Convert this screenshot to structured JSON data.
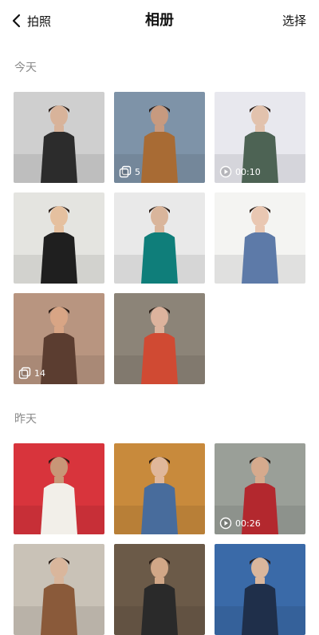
{
  "header": {
    "back_label": "拍照",
    "title": "相册",
    "select_label": "选择"
  },
  "sections": [
    {
      "label": "今天",
      "tiles": [
        {
          "name": "photo-woman-black-vest",
          "bg": "#cfcfcf",
          "accent": "#2c2c2c",
          "skin": "#d8b39a",
          "badge": null
        },
        {
          "name": "photo-man-brown-jacket",
          "bg": "#7e93a8",
          "accent": "#a86b34",
          "skin": "#c79a7f",
          "badge": {
            "type": "multi",
            "text": "5"
          }
        },
        {
          "name": "photo-woman-green-top",
          "bg": "#e8e8ee",
          "accent": "#4d6354",
          "skin": "#e2c2ad",
          "badge": {
            "type": "video",
            "text": "00:10"
          }
        },
        {
          "name": "photo-woman-glasses-bomber",
          "bg": "#e4e4e0",
          "accent": "#1f1f1f",
          "skin": "#e5c09f",
          "badge": null
        },
        {
          "name": "photo-teal-sweater-bag",
          "bg": "#e9e9e9",
          "accent": "#0f7e7a",
          "skin": "#d9b59b",
          "badge": null
        },
        {
          "name": "photo-woman-denim-overalls",
          "bg": "#f4f4f2",
          "accent": "#5d7aa8",
          "skin": "#e9c7b2",
          "badge": null
        },
        {
          "name": "photo-woman-profile-warm",
          "bg": "#b89580",
          "accent": "#5b3d30",
          "skin": "#d8a585",
          "badge": {
            "type": "multi",
            "text": "14"
          }
        },
        {
          "name": "photo-woman-red-pants-shutter",
          "bg": "#8c8478",
          "accent": "#d04a33",
          "skin": "#dcb39d",
          "badge": null
        }
      ]
    },
    {
      "label": "昨天",
      "tiles": [
        {
          "name": "photo-so-it-goes-tee",
          "bg": "#d8343c",
          "accent": "#f2efe9",
          "skin": "#c89677",
          "badge": null
        },
        {
          "name": "photo-denim-jacket-floral",
          "bg": "#c88a3c",
          "accent": "#486c9c",
          "skin": "#e0b79a",
          "badge": null
        },
        {
          "name": "photo-woman-red-trousers-street",
          "bg": "#9a9f98",
          "accent": "#b3282e",
          "skin": "#d6aa8d",
          "badge": {
            "type": "video",
            "text": "00:26"
          }
        },
        {
          "name": "photo-partial-4",
          "bg": "#c9c2b7",
          "accent": "#8a5a3a",
          "skin": "#d9b69c",
          "badge": null
        },
        {
          "name": "photo-partial-5",
          "bg": "#6b5a48",
          "accent": "#2a2a2a",
          "skin": "#d1a787",
          "badge": null
        },
        {
          "name": "photo-partial-6",
          "bg": "#3a6aa8",
          "accent": "#1f2f4a",
          "skin": "#d9b69c",
          "badge": null
        }
      ]
    }
  ]
}
